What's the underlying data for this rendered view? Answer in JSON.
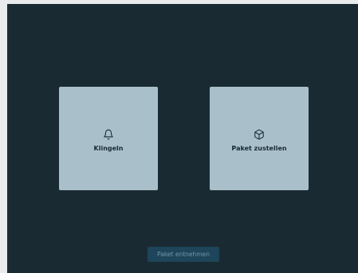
{
  "tiles": {
    "ring": {
      "label": "Klingeln",
      "icon": "bell-icon"
    },
    "deliver": {
      "label": "Paket zustellen",
      "icon": "package-icon"
    }
  },
  "actions": {
    "take_package_label": "Paket entnehmen"
  },
  "colors": {
    "background": "#1a2a33",
    "tile": "#a9c0cb",
    "button": "#1e4559",
    "button_text": "#6f98ad"
  }
}
